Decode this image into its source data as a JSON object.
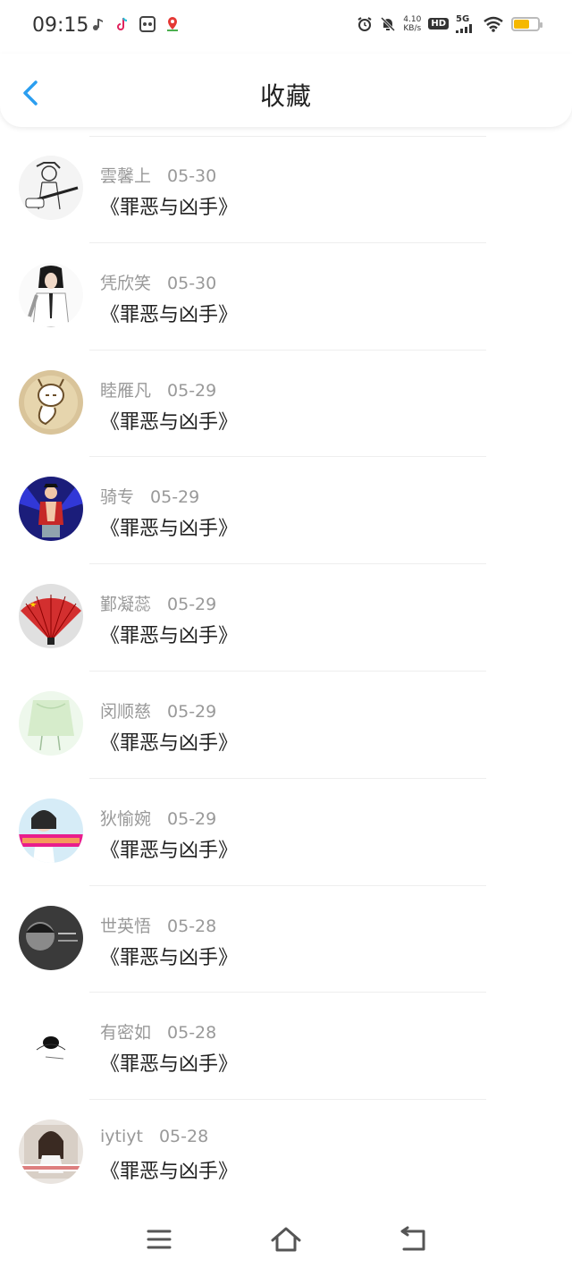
{
  "status_bar": {
    "time": "09:15",
    "net_speed_value": "4.10",
    "net_speed_unit": "KB/s",
    "hd_label": "HD",
    "network_label": "5G",
    "battery_level": 0.65,
    "battery_color": "#f5b800"
  },
  "header": {
    "title": "收藏",
    "back_icon": "chevron-left-icon",
    "accent_color": "#2b9ef0"
  },
  "items": [
    {
      "name": "雲馨上",
      "date": "05-30",
      "title": "《罪恶与凶手》"
    },
    {
      "name": "凭欣笑",
      "date": "05-30",
      "title": "《罪恶与凶手》"
    },
    {
      "name": "睦雁凡",
      "date": "05-29",
      "title": "《罪恶与凶手》"
    },
    {
      "name": "骑专",
      "date": "05-29",
      "title": "《罪恶与凶手》"
    },
    {
      "name": "鄞凝蕊",
      "date": "05-29",
      "title": "《罪恶与凶手》"
    },
    {
      "name": "闵顺慈",
      "date": "05-29",
      "title": "《罪恶与凶手》"
    },
    {
      "name": "狄愉婉",
      "date": "05-29",
      "title": "《罪恶与凶手》"
    },
    {
      "name": "世英悟",
      "date": "05-28",
      "title": "《罪恶与凶手》"
    },
    {
      "name": "有密如",
      "date": "05-28",
      "title": "《罪恶与凶手》"
    },
    {
      "name": "iytiyt",
      "date": "05-28",
      "title": "《罪恶与凶手》"
    }
  ],
  "bottom_nav": {
    "menu_icon": "menu-icon",
    "home_icon": "home-icon",
    "back_icon": "back-icon"
  }
}
